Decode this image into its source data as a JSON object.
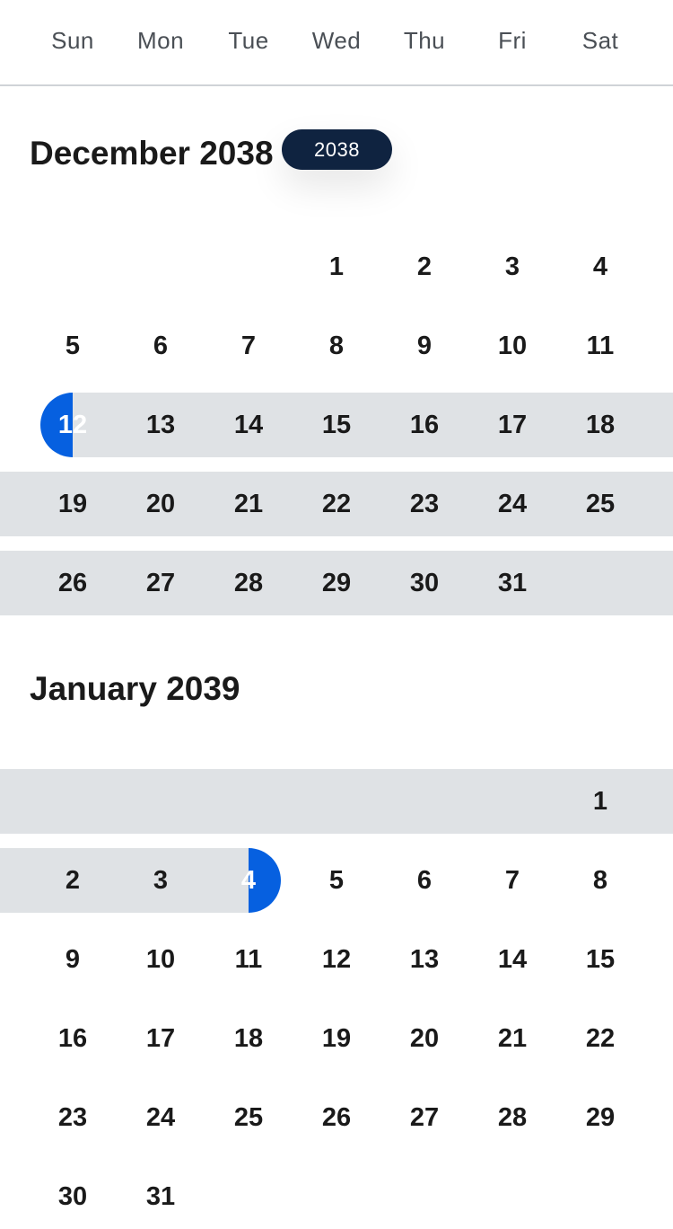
{
  "weekdays": [
    "Sun",
    "Mon",
    "Tue",
    "Wed",
    "Thu",
    "Fri",
    "Sat"
  ],
  "year_indicator": "2038",
  "colors": {
    "accent": "#0660e0",
    "range_band": "#dfe2e5",
    "pill": "#0f2340"
  },
  "months": [
    {
      "title": "December 2038",
      "weeks": [
        {
          "days": [
            "",
            "",
            "",
            "1",
            "2",
            "3",
            "4"
          ],
          "band": null
        },
        {
          "days": [
            "5",
            "6",
            "7",
            "8",
            "9",
            "10",
            "11"
          ],
          "band": null
        },
        {
          "days": [
            "12",
            "13",
            "14",
            "15",
            "16",
            "17",
            "18"
          ],
          "band": "from-start-selected"
        },
        {
          "days": [
            "19",
            "20",
            "21",
            "22",
            "23",
            "24",
            "25"
          ],
          "band": "full"
        },
        {
          "days": [
            "26",
            "27",
            "28",
            "29",
            "30",
            "31",
            ""
          ],
          "band": "full"
        }
      ],
      "selected": {
        "week": 2,
        "col": 0
      }
    },
    {
      "title": "January 2039",
      "weeks": [
        {
          "days": [
            "",
            "",
            "",
            "",
            "",
            "",
            "1"
          ],
          "band": "full"
        },
        {
          "days": [
            "2",
            "3",
            "4",
            "5",
            "6",
            "7",
            "8"
          ],
          "band": "to-end-selected"
        },
        {
          "days": [
            "9",
            "10",
            "11",
            "12",
            "13",
            "14",
            "15"
          ],
          "band": null
        },
        {
          "days": [
            "16",
            "17",
            "18",
            "19",
            "20",
            "21",
            "22"
          ],
          "band": null
        },
        {
          "days": [
            "23",
            "24",
            "25",
            "26",
            "27",
            "28",
            "29"
          ],
          "band": null
        },
        {
          "days": [
            "30",
            "31",
            "",
            "",
            "",
            "",
            ""
          ],
          "band": null
        }
      ],
      "selected": {
        "week": 1,
        "col": 2
      }
    }
  ]
}
